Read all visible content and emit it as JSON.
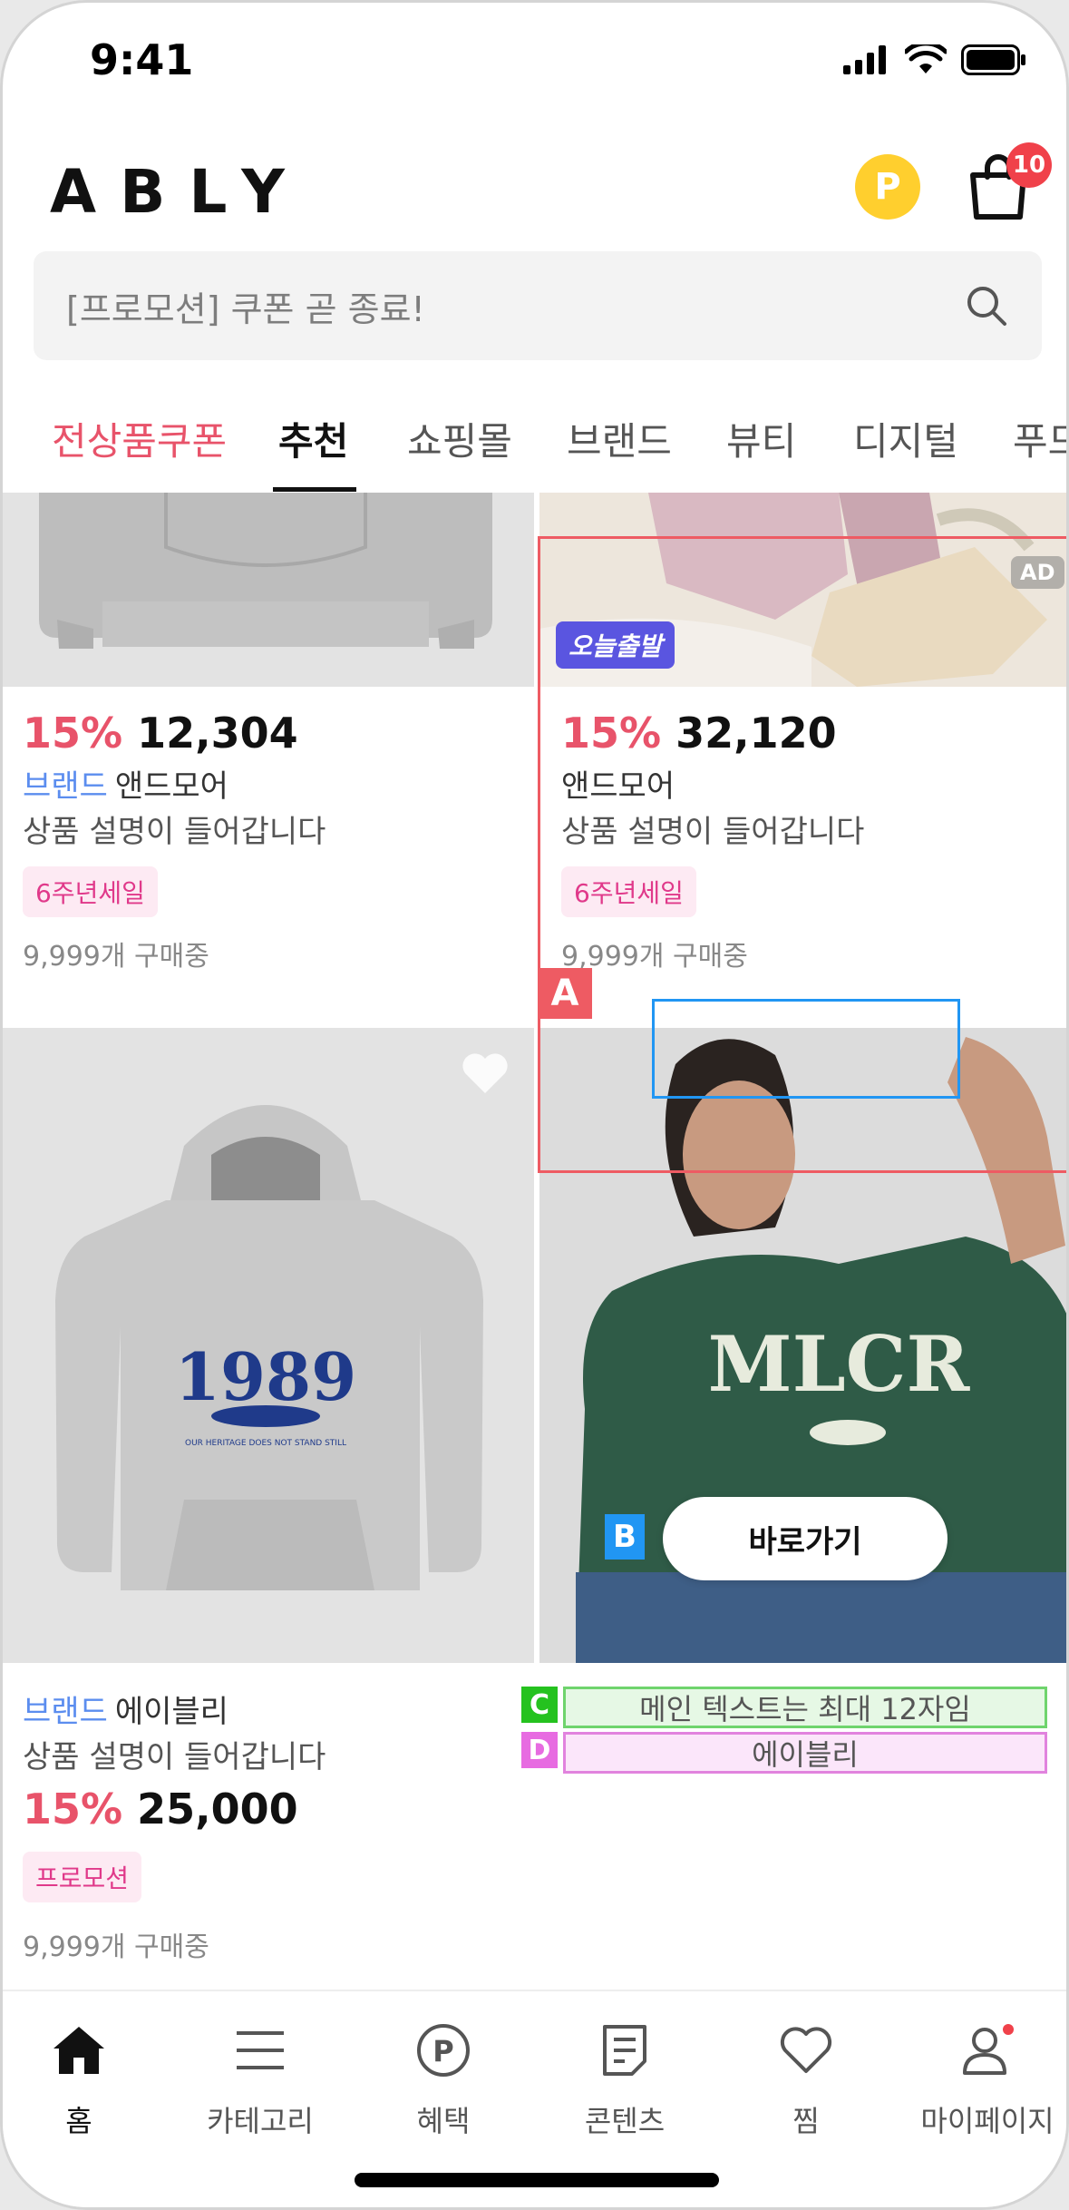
{
  "status_bar": {
    "time": "9:41"
  },
  "header": {
    "logo": "ABLY",
    "point_label": "P",
    "cart_count": "10"
  },
  "search": {
    "placeholder": "[프로모션] 쿠폰 곧 종료!"
  },
  "tabs": [
    "전상품쿠폰",
    "추천",
    "쇼핑몰",
    "브랜드",
    "뷰티",
    "디지털",
    "푸드"
  ],
  "active_tab": "추천",
  "products": [
    {
      "discount": "15%",
      "price": "12,304",
      "brand_prefix": "브랜드",
      "brand": "앤드모어",
      "description": "상품 설명이 들어갑니다",
      "tag": "6주년세일",
      "buyers": "9,999개 구매중"
    },
    {
      "badge": "오늘출발",
      "discount": "15%",
      "price": "32,120",
      "brand": "앤드모어",
      "description": "상품 설명이 들어갑니다",
      "tag": "6주년세일",
      "buyers": "9,999개 구매중"
    },
    {
      "discount": "15%",
      "price": "25,000",
      "brand_prefix": "브랜드",
      "brand": "에이블리",
      "description": "상품 설명이 들어갑니다",
      "tag": "프로모션",
      "buyers": "9,999개 구매중"
    }
  ],
  "ad": {
    "ad_chip": "AD",
    "cta": "바로가기",
    "main_text": "메인 텍스트는 최대 12자임",
    "sub_text": "에이블리",
    "annotations": [
      "A",
      "B",
      "C",
      "D"
    ]
  },
  "bottom_nav": [
    {
      "label": "홈",
      "icon": "home-icon"
    },
    {
      "label": "카테고리",
      "icon": "menu-icon"
    },
    {
      "label": "혜택",
      "icon": "point-icon"
    },
    {
      "label": "콘텐츠",
      "icon": "content-icon"
    },
    {
      "label": "찜",
      "icon": "heart-icon"
    },
    {
      "label": "마이페이지",
      "icon": "person-icon"
    }
  ],
  "colors": {
    "discount": "#E8536A",
    "brand_link": "#5B8DEF",
    "tag_bg": "#FDEAF3",
    "tag_text": "#E0398A",
    "point": "#FFCF2E",
    "badge": "#F0414A"
  }
}
